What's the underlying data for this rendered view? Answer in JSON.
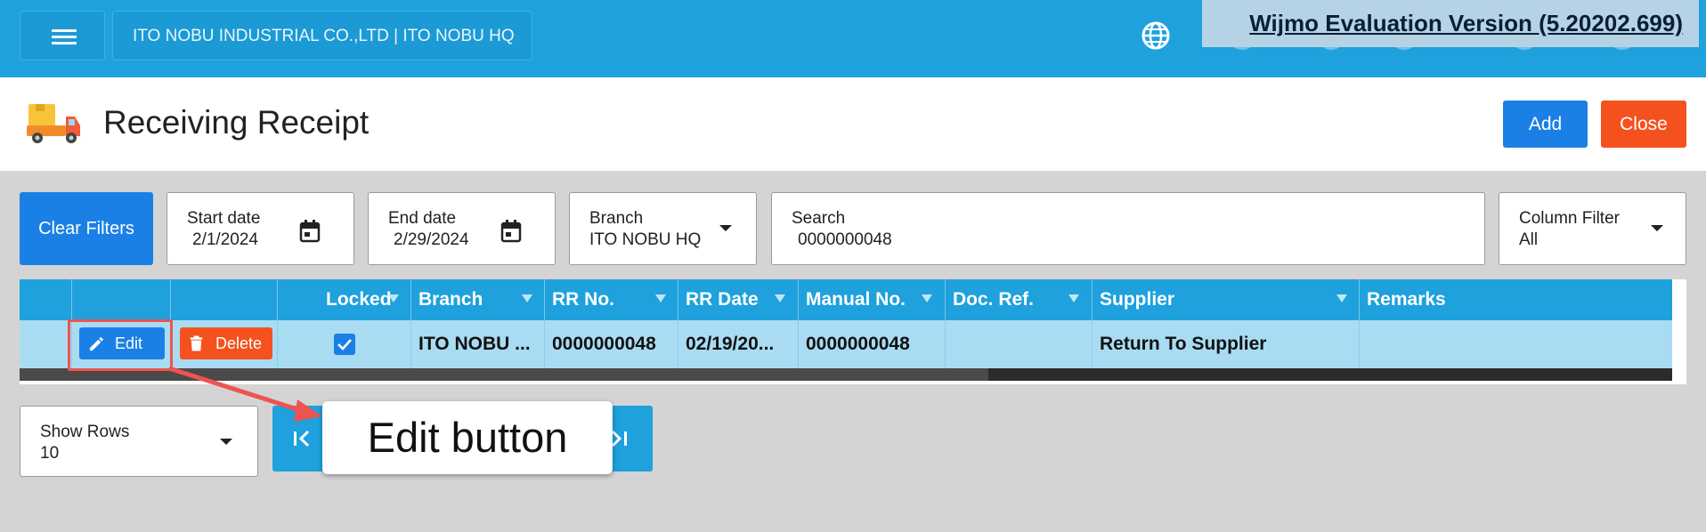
{
  "topbar": {
    "company": "ITO NOBU INDUSTRIAL CO.,LTD | ITO NOBU HQ",
    "watermark": "Wijmo Evaluation Version (5.20202.699)"
  },
  "header": {
    "title": "Receiving Receipt",
    "add_label": "Add",
    "close_label": "Close"
  },
  "filters": {
    "clear_label": "Clear Filters",
    "start_date": {
      "label": "Start date",
      "value": "2/1/2024"
    },
    "end_date": {
      "label": "End date",
      "value": "2/29/2024"
    },
    "branch": {
      "label": "Branch",
      "value": "ITO NOBU HQ"
    },
    "search": {
      "label": "Search",
      "value": "0000000048"
    },
    "column_filter": {
      "label": "Column Filter",
      "value": "All"
    }
  },
  "grid": {
    "columns": [
      "Locked",
      "Branch",
      "RR No.",
      "RR Date",
      "Manual No.",
      "Doc. Ref.",
      "Supplier",
      "Remarks"
    ],
    "row": {
      "edit_label": "Edit",
      "delete_label": "Delete",
      "locked": true,
      "branch": "ITO NOBU ...",
      "rr_no": "0000000048",
      "rr_date": "02/19/20...",
      "manual_no": "0000000048",
      "doc_ref": "",
      "supplier": "Return To Supplier",
      "remarks": ""
    }
  },
  "pager": {
    "show_rows_label": "Show Rows",
    "show_rows_value": "10"
  },
  "annotation": {
    "callout": "Edit button"
  },
  "colors": {
    "topbar": "#1ea1dd",
    "primary": "#1b80e6",
    "danger": "#f4511e",
    "row_selected": "#a9dcf3"
  }
}
